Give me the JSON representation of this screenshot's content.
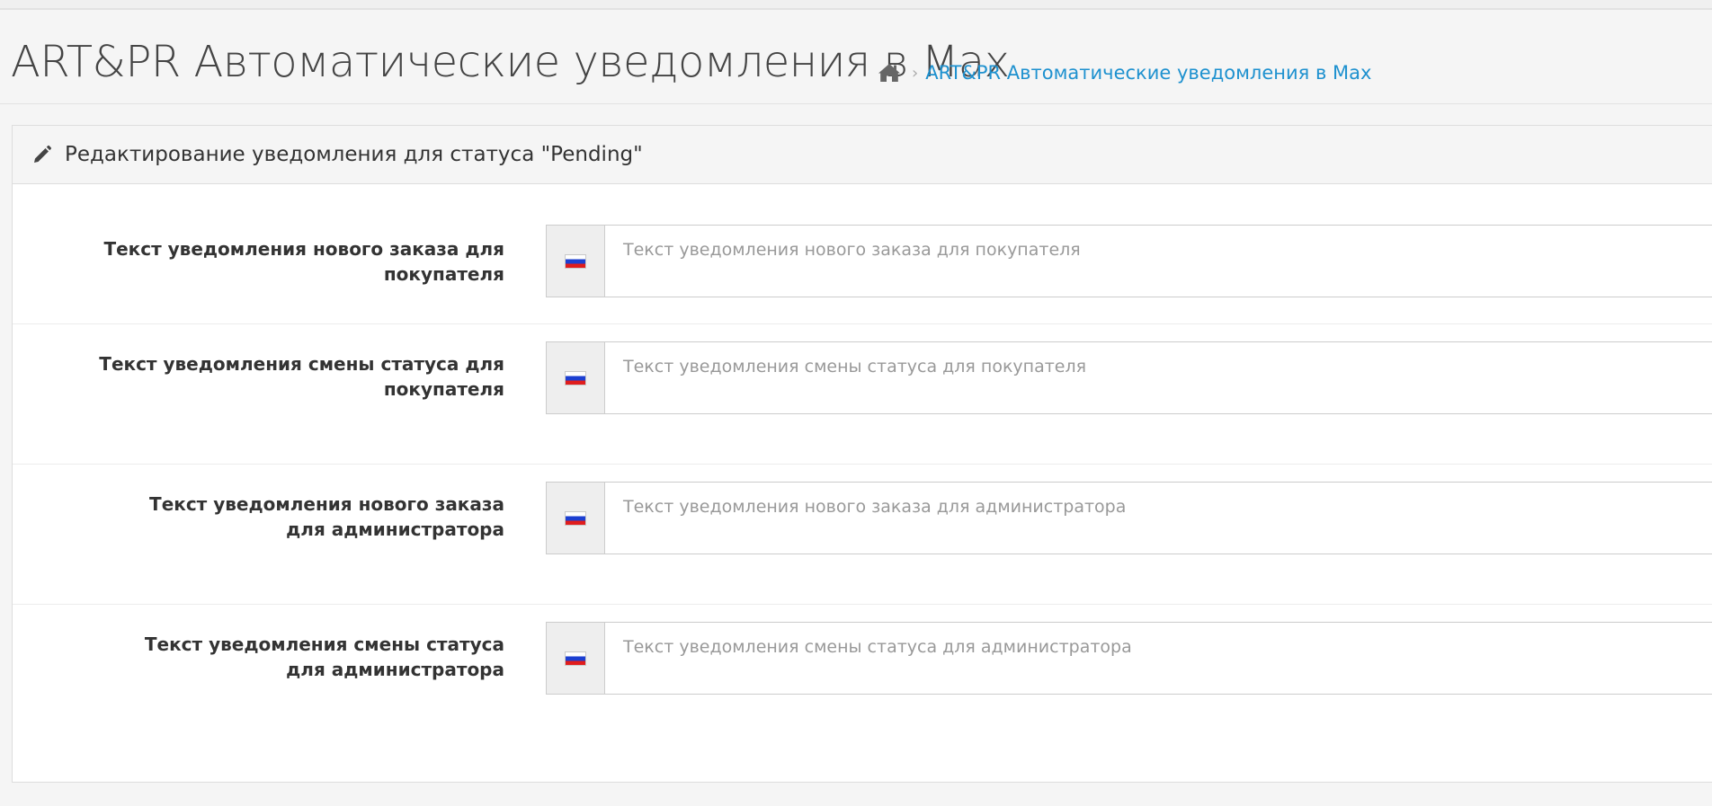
{
  "header": {
    "title": "ART&PR Автоматические уведомления в Max",
    "breadcrumb": {
      "home_icon": "home-icon",
      "separator": "›",
      "link_label": "ART&PR Автоматические уведомления в Max"
    }
  },
  "panel": {
    "icon": "pencil-icon",
    "title": "Редактирование уведомления для статуса \"Pending\""
  },
  "fields": [
    {
      "label": "Текст уведомления нового заказа для покупателя",
      "placeholder": "Текст уведомления нового заказа для покупателя",
      "value": "",
      "language_icon": "russian-flag-icon"
    },
    {
      "label": "Текст уведомления смены статуса для покупателя",
      "placeholder": "Текст уведомления смены статуса для покупателя",
      "value": "",
      "language_icon": "russian-flag-icon"
    },
    {
      "label": "Текст уведомления нового заказа для администратора",
      "placeholder": "Текст уведомления нового заказа для администратора",
      "value": "",
      "language_icon": "russian-flag-icon"
    },
    {
      "label": "Текст уведомления смены статуса для администратора",
      "placeholder": "Текст уведомления смены статуса для администратора",
      "value": "",
      "language_icon": "russian-flag-icon"
    }
  ],
  "colors": {
    "link": "#1e91cf",
    "background": "#f5f5f5",
    "panel_border": "#dddddd",
    "flag_white": "#ffffff",
    "flag_blue": "#1c3fd1",
    "flag_red": "#e01c1c"
  }
}
